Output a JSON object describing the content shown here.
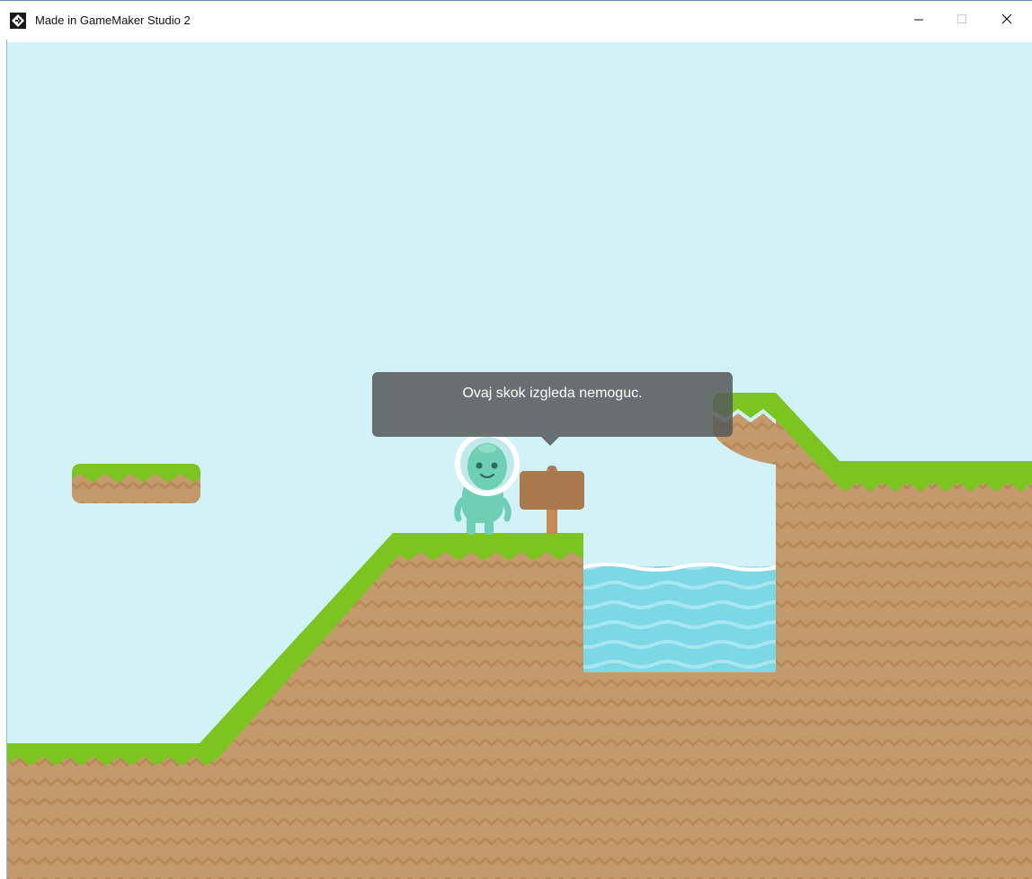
{
  "window": {
    "title": "Made in GameMaker Studio 2",
    "app_icon": "gamemaker-icon",
    "controls": {
      "minimize_icon": "minimize-icon",
      "maximize_icon": "maximize-icon",
      "close_icon": "close-icon"
    }
  },
  "game": {
    "dialog": {
      "text": "Ovaj skok izgleda nemoguc."
    },
    "colors": {
      "sky": "#d1f2f7",
      "grass": "#7cc521",
      "grass_dark": "#6aae1a",
      "dirt": "#c49a6c",
      "dirt_pattern": "#b9895b",
      "water": "#7ddbe8",
      "water_wave": "#a9e8f1",
      "wood": "#a9784c",
      "player": "#6fcfb5",
      "bubble": "#555a58"
    },
    "entities": {
      "player_icon": "alien-player-icon",
      "sign_icon": "wooden-sign-icon"
    }
  }
}
